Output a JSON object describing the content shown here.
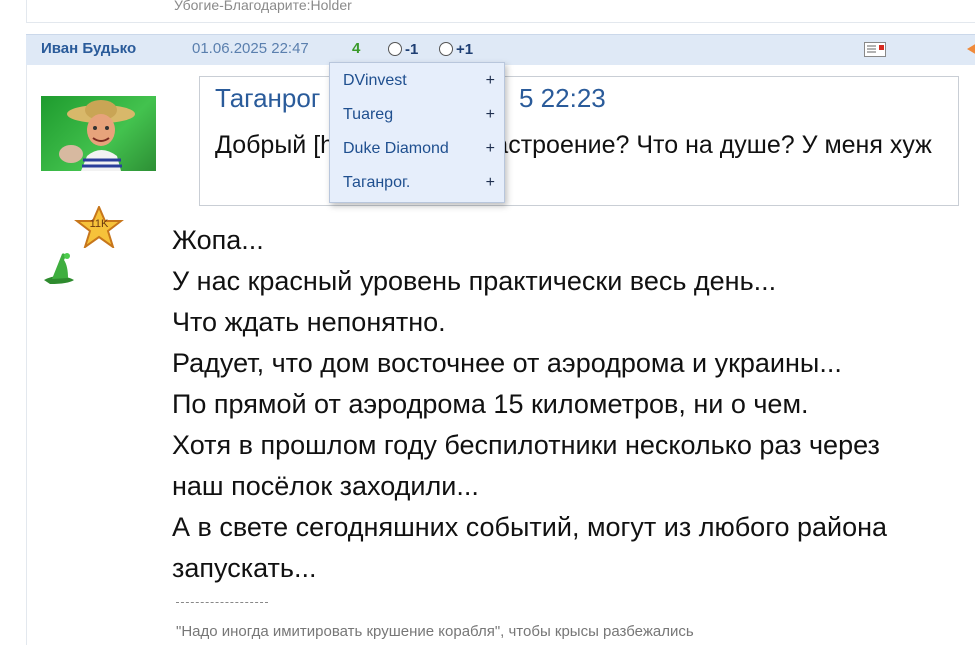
{
  "previous_post": {
    "signature": "Убогие-Благодарите:Holder"
  },
  "post": {
    "author": "Иван Будько",
    "date": "01.06.2025 22:47",
    "rating": "4",
    "vote_minus_label": "-1",
    "vote_plus_label": "+1",
    "badge_label": "11K",
    "quote": {
      "author": "Таганрог",
      "time": "5 22:23",
      "text": "Добрый [hidden] какое настроение? Что на душе? У меня хуж"
    },
    "message_lines": [
      "Жопа...",
      "У нас красный уровень практически весь день...",
      "Что ждать непонятно.",
      "Радует, что дом восточнее от аэродрома и украины...",
      "По прямой от аэродрома 15 километров, ни о чем.",
      "Хотя в прошлом году беспилотники несколько раз через",
      "наш посёлок заходили...",
      "А в свете сегодняшних событий, могут из любого района",
      "запускать..."
    ],
    "signature_separator": "--------------------",
    "signature": "\"Надо иногда имитировать крушение корабля\", чтобы крысы разбежались"
  },
  "rating_dropdown": {
    "items": [
      {
        "name": "DVinvest",
        "action": "+"
      },
      {
        "name": "Tuareg",
        "action": "+"
      },
      {
        "name": "Duke Diamond",
        "action": "+"
      },
      {
        "name": "Таганрог.",
        "action": "+"
      }
    ]
  },
  "icons": {
    "mail": "mail-icon",
    "arrow": "arrow-left-icon",
    "star": "star-badge-icon",
    "hat": "wizard-hat-icon"
  },
  "colors": {
    "header_bg": "#dfe9f6",
    "author": "#2a5b9a",
    "rating": "#3a9a2a",
    "dropdown_bg": "#e6eefb"
  }
}
